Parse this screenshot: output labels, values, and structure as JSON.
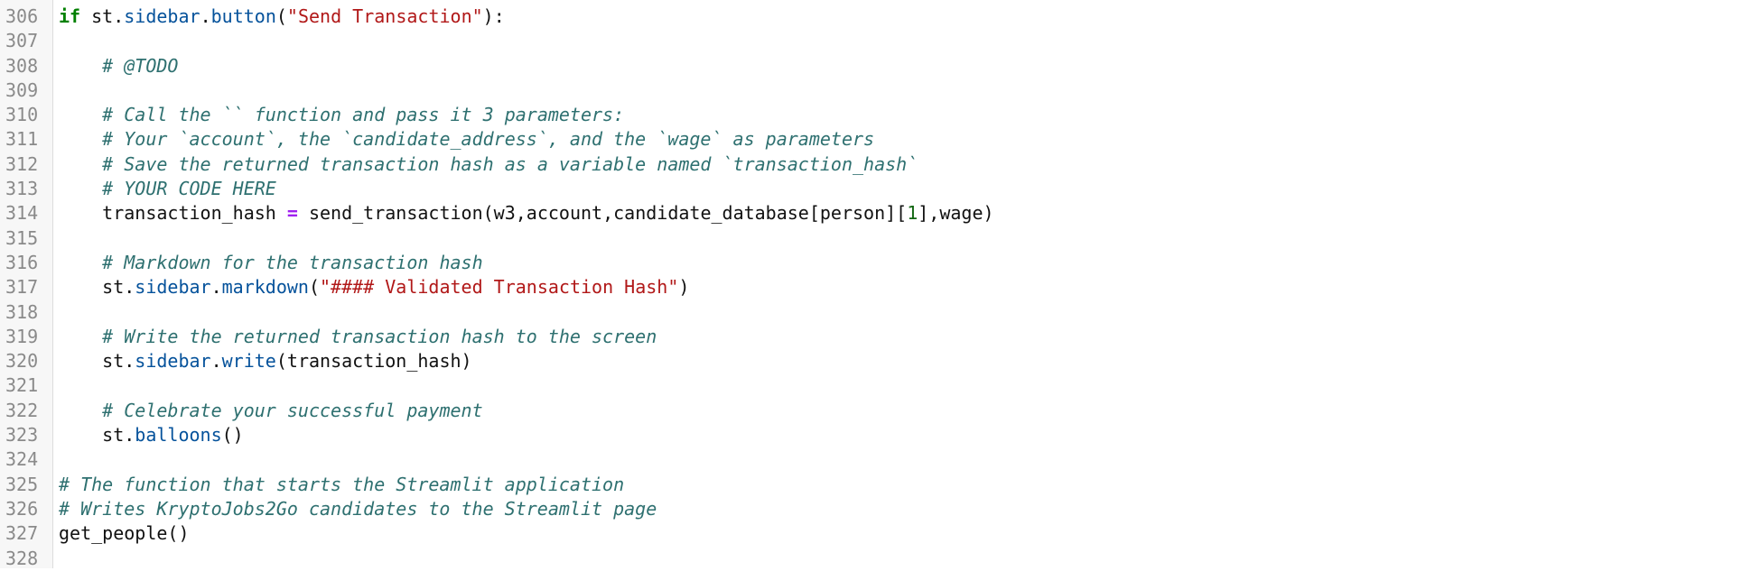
{
  "editor": {
    "lines": [
      {
        "number": "306",
        "tokens": [
          {
            "t": "if",
            "k": "kw"
          },
          {
            "t": " st.",
            "k": "plain"
          },
          {
            "t": "sidebar",
            "k": "attr"
          },
          {
            "t": ".",
            "k": "plain"
          },
          {
            "t": "button",
            "k": "attr"
          },
          {
            "t": "(",
            "k": "plain"
          },
          {
            "t": "\"Send Transaction\"",
            "k": "str"
          },
          {
            "t": "):",
            "k": "plain"
          }
        ]
      },
      {
        "number": "307",
        "tokens": []
      },
      {
        "number": "308",
        "tokens": [
          {
            "t": "    ",
            "k": "plain"
          },
          {
            "t": "# @TODO",
            "k": "cmt"
          }
        ]
      },
      {
        "number": "309",
        "tokens": []
      },
      {
        "number": "310",
        "tokens": [
          {
            "t": "    ",
            "k": "plain"
          },
          {
            "t": "# Call the `` function and pass it 3 parameters:",
            "k": "cmt"
          }
        ]
      },
      {
        "number": "311",
        "tokens": [
          {
            "t": "    ",
            "k": "plain"
          },
          {
            "t": "# Your `account`, the `candidate_address`, and the `wage` as parameters",
            "k": "cmt"
          }
        ]
      },
      {
        "number": "312",
        "tokens": [
          {
            "t": "    ",
            "k": "plain"
          },
          {
            "t": "# Save the returned transaction hash as a variable named `transaction_hash`",
            "k": "cmt"
          }
        ]
      },
      {
        "number": "313",
        "tokens": [
          {
            "t": "    ",
            "k": "plain"
          },
          {
            "t": "# YOUR CODE HERE",
            "k": "cmt"
          }
        ]
      },
      {
        "number": "314",
        "tokens": [
          {
            "t": "    transaction_hash ",
            "k": "plain"
          },
          {
            "t": "=",
            "k": "op"
          },
          {
            "t": " send_transaction(w3,account,candidate_database[person][",
            "k": "plain"
          },
          {
            "t": "1",
            "k": "num"
          },
          {
            "t": "],wage)",
            "k": "plain"
          }
        ]
      },
      {
        "number": "315",
        "tokens": []
      },
      {
        "number": "316",
        "tokens": [
          {
            "t": "    ",
            "k": "plain"
          },
          {
            "t": "# Markdown for the transaction hash",
            "k": "cmt"
          }
        ]
      },
      {
        "number": "317",
        "tokens": [
          {
            "t": "    st.",
            "k": "plain"
          },
          {
            "t": "sidebar",
            "k": "attr"
          },
          {
            "t": ".",
            "k": "plain"
          },
          {
            "t": "markdown",
            "k": "attr"
          },
          {
            "t": "(",
            "k": "plain"
          },
          {
            "t": "\"#### Validated Transaction Hash\"",
            "k": "str"
          },
          {
            "t": ")",
            "k": "plain"
          }
        ]
      },
      {
        "number": "318",
        "tokens": []
      },
      {
        "number": "319",
        "tokens": [
          {
            "t": "    ",
            "k": "plain"
          },
          {
            "t": "# Write the returned transaction hash to the screen",
            "k": "cmt"
          }
        ]
      },
      {
        "number": "320",
        "tokens": [
          {
            "t": "    st.",
            "k": "plain"
          },
          {
            "t": "sidebar",
            "k": "attr"
          },
          {
            "t": ".",
            "k": "plain"
          },
          {
            "t": "write",
            "k": "attr"
          },
          {
            "t": "(transaction_hash)",
            "k": "plain"
          }
        ]
      },
      {
        "number": "321",
        "tokens": []
      },
      {
        "number": "322",
        "tokens": [
          {
            "t": "    ",
            "k": "plain"
          },
          {
            "t": "# Celebrate your successful payment",
            "k": "cmt"
          }
        ]
      },
      {
        "number": "323",
        "tokens": [
          {
            "t": "    st.",
            "k": "plain"
          },
          {
            "t": "balloons",
            "k": "attr"
          },
          {
            "t": "()",
            "k": "plain"
          }
        ]
      },
      {
        "number": "324",
        "tokens": []
      },
      {
        "number": "325",
        "tokens": [
          {
            "t": "# The function that starts the Streamlit application",
            "k": "cmt"
          }
        ]
      },
      {
        "number": "326",
        "tokens": [
          {
            "t": "# Writes KryptoJobs2Go candidates to the Streamlit page",
            "k": "cmt"
          }
        ]
      },
      {
        "number": "327",
        "tokens": [
          {
            "t": "get_people()",
            "k": "plain"
          }
        ]
      },
      {
        "number": "328",
        "tokens": []
      }
    ]
  }
}
